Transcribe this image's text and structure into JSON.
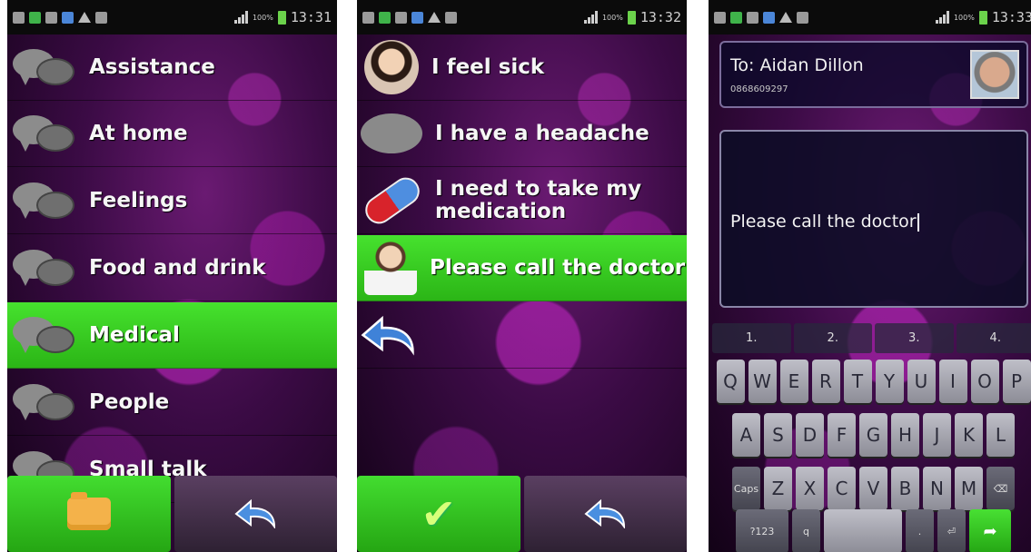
{
  "status_bar": [
    {
      "time": "13:31",
      "battery": "100%"
    },
    {
      "time": "13:32",
      "battery": "100%"
    },
    {
      "time": "13:33",
      "battery": "100%"
    }
  ],
  "screen1": {
    "categories": [
      "Assistance",
      "At home",
      "Feelings",
      "Food and drink",
      "Medical",
      "People",
      "Small talk"
    ],
    "selected": "Medical"
  },
  "screen2": {
    "phrases": [
      "I feel sick",
      "I have a headache",
      "I need to take my medication",
      "Please call the doctor"
    ],
    "selected": "Please call the doctor"
  },
  "screen3": {
    "to_label": "To: Aidan Dillon",
    "to_phone": "0868609297",
    "message": "Please call the doctor",
    "number_row": [
      "1.",
      "2.",
      "3.",
      "4."
    ],
    "row1": [
      "Q",
      "W",
      "E",
      "R",
      "T",
      "Y",
      "U",
      "I",
      "O",
      "P"
    ],
    "row2": [
      "A",
      "S",
      "D",
      "F",
      "G",
      "H",
      "J",
      "K",
      "L"
    ],
    "row3_left": "Caps",
    "row3": [
      "Z",
      "X",
      "C",
      "V",
      "B",
      "N",
      "M"
    ],
    "bottom_left": "?123",
    "comma": "q",
    "period": "."
  },
  "icons": {
    "folder": "folder-icon",
    "back": "back-arrow-icon",
    "confirm": "check-icon",
    "delete": "backspace-icon",
    "enter": "enter-icon",
    "send": "send-icon"
  },
  "colors": {
    "accent_green": "#3bd126",
    "panel_bg": "#3b0b45"
  }
}
